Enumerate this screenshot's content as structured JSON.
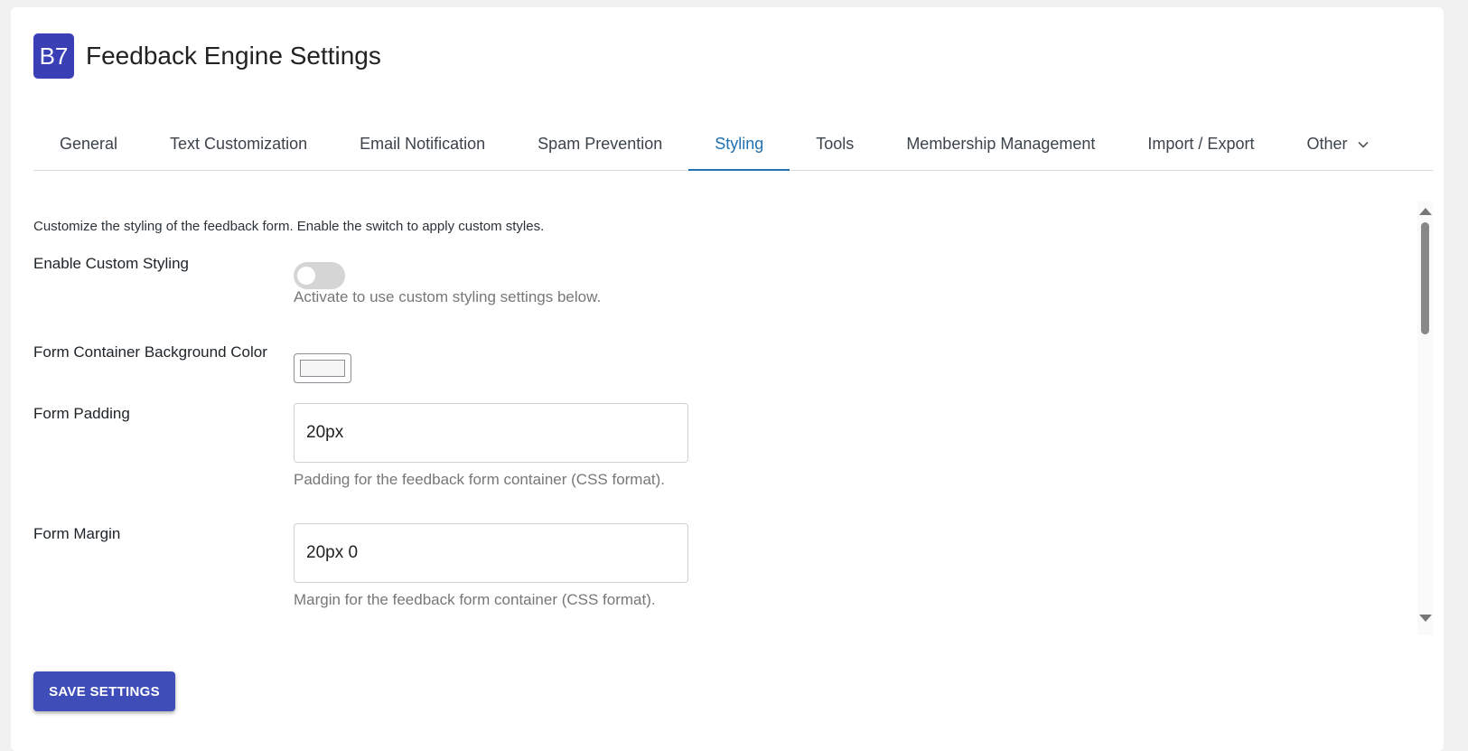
{
  "header": {
    "logo_text": "B7",
    "title": "Feedback Engine Settings"
  },
  "tabs": [
    {
      "label": "General"
    },
    {
      "label": "Text Customization"
    },
    {
      "label": "Email Notification"
    },
    {
      "label": "Spam Prevention"
    },
    {
      "label": "Styling",
      "active": true
    },
    {
      "label": "Tools"
    },
    {
      "label": "Membership Management"
    },
    {
      "label": "Import / Export"
    },
    {
      "label": "Other",
      "icon": "chevron-down-icon"
    }
  ],
  "content": {
    "intro": "Customize the styling of the feedback form. Enable the switch to apply custom styles.",
    "enable_custom_styling": {
      "label": "Enable Custom Styling",
      "checked": false,
      "description": "Activate to use custom styling settings below."
    },
    "bg_color": {
      "label": "Form Container Background Color",
      "value": "#f6f6f6"
    },
    "form_padding": {
      "label": "Form Padding",
      "value": "20px",
      "description": "Padding for the feedback form container (CSS format)."
    },
    "form_margin": {
      "label": "Form Margin",
      "value": "20px 0",
      "description": "Margin for the feedback form container (CSS format)."
    }
  },
  "actions": {
    "save_label": "SAVE SETTINGS"
  },
  "colors": {
    "brand": "#3b3fb5",
    "active_tab": "#2271b1",
    "button": "#3f4db8"
  }
}
